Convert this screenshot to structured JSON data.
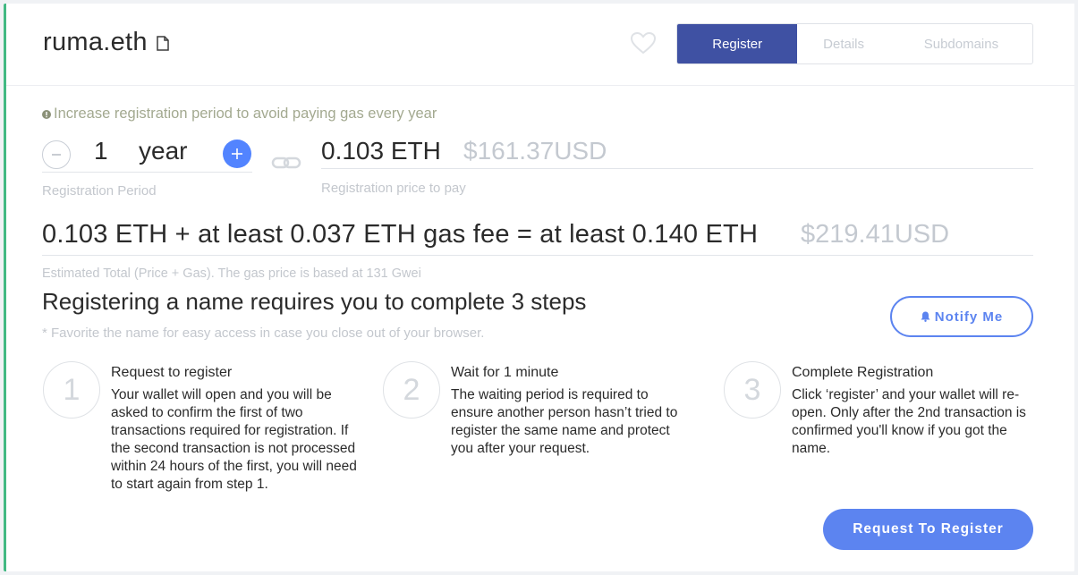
{
  "header": {
    "domain": "ruma.eth",
    "tabs": [
      {
        "label": "Register",
        "active": true
      },
      {
        "label": "Details",
        "active": false
      },
      {
        "label": "Subdomains",
        "active": false
      }
    ]
  },
  "registration": {
    "hint": "Increase registration period to avoid paying gas every year",
    "period_value": "1",
    "period_unit": "year",
    "period_label": "Registration Period",
    "price_eth": "0.103 ETH",
    "price_usd": "$161.37USD",
    "price_label": "Registration price to pay"
  },
  "estimate": {
    "total_text": "0.103 ETH + at least 0.037 ETH gas fee = at least 0.140 ETH",
    "total_usd": "$219.41USD",
    "label": "Estimated Total (Price + Gas). The gas price is based at 131 Gwei"
  },
  "steps_section": {
    "heading": "Registering a name requires you to complete 3 steps",
    "note": "* Favorite the name for easy access in case you close out of your browser.",
    "notify_label": "Notify Me",
    "steps": [
      {
        "number": "1",
        "title": "Request to register",
        "body": "Your wallet will open and you will be asked to confirm the first of two transactions required for registration. If the second transaction is not processed within 24 hours of the first, you will need to start again from step 1."
      },
      {
        "number": "2",
        "title": "Wait for 1 minute",
        "body": "The waiting period is required to ensure another person hasn’t tried to register the same name and protect you after your request."
      },
      {
        "number": "3",
        "title": "Complete Registration",
        "body": "Click ‘register’ and your wallet will re-open. Only after the 2nd transaction is confirmed you'll know if you got the name."
      }
    ],
    "request_label": "Request To Register"
  },
  "colors": {
    "accent": "#5c84f0",
    "tab_active": "#3f51a3",
    "left_border": "#42b983"
  },
  "icons": [
    "document-icon",
    "heart-icon",
    "info-icon",
    "minus-icon",
    "plus-icon",
    "link-icon",
    "bell-icon"
  ]
}
